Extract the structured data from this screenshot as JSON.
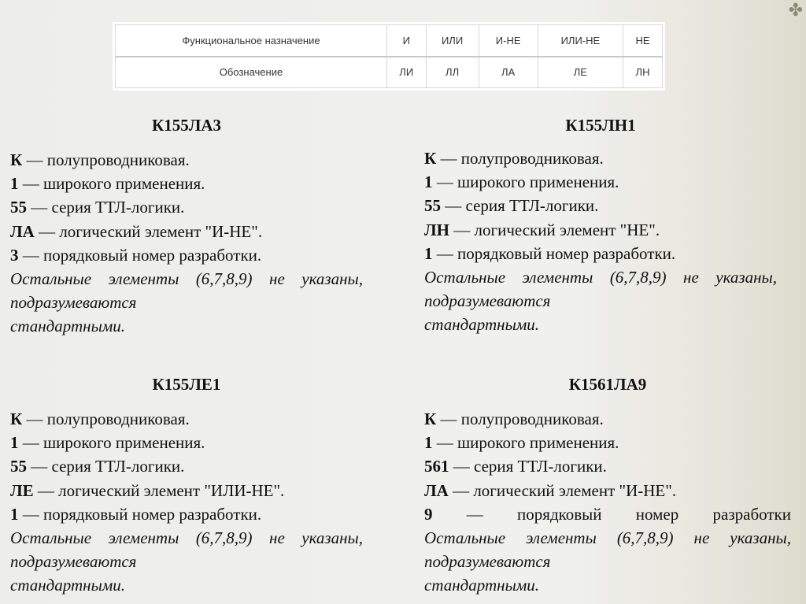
{
  "table": {
    "headers": [
      "Функциональное назначение",
      "И",
      "ИЛИ",
      "И-НЕ",
      "ИЛИ-НЕ",
      "НЕ"
    ],
    "codes": [
      "Обозначение",
      "ЛИ",
      "ЛЛ",
      "ЛА",
      "ЛЕ",
      "ЛН"
    ]
  },
  "decorations": {
    "corner_icon": "✤"
  },
  "blocks": [
    {
      "title": "К155ЛА3",
      "lines": [
        {
          "code": "К",
          "text": " — полупроводниковая."
        },
        {
          "code": "1",
          "text": " — широкого применения."
        },
        {
          "code": "55",
          "text": " — серия ТТЛ-логики."
        },
        {
          "code": "ЛА",
          "text": " — логический элемент \"И-НЕ\"."
        },
        {
          "code": "3",
          "text": " — порядковый номер разработки."
        }
      ],
      "note_main": "Остальные элементы (6,7,8,9) не указаны, подразумеваются",
      "note_last": "стандартными."
    },
    {
      "title": "К155ЛН1",
      "lines": [
        {
          "code": "К",
          "text": " — полупроводниковая."
        },
        {
          "code": "1",
          "text": " — широкого применения."
        },
        {
          "code": "55",
          "text": " — серия ТТЛ-логики."
        },
        {
          "code": "ЛН",
          "text": " — логический элемент \"НЕ\"."
        },
        {
          "code": "1",
          "text": " — порядковый номер разработки."
        }
      ],
      "note_main": "Остальные элементы (6,7,8,9) не указаны, подразумеваются",
      "note_last": "стандартными."
    },
    {
      "title": "К155ЛЕ1",
      "lines": [
        {
          "code": "К",
          "text": " — полупроводниковая."
        },
        {
          "code": "1",
          "text": " — широкого применения."
        },
        {
          "code": "55",
          "text": " — серия ТТЛ-логики."
        },
        {
          "code": "ЛЕ",
          "text": " — логический элемент \"ИЛИ-НЕ\"."
        },
        {
          "code": "1",
          "text": " — порядковый номер разработки."
        }
      ],
      "note_main": "Остальные элементы (6,7,8,9) не указаны, подразумеваются",
      "note_last": "стандартными."
    },
    {
      "title": "К1561ЛА9",
      "lines": [
        {
          "code": "К",
          "text": " — полупроводниковая."
        },
        {
          "code": "1",
          "text": " — широкого применения."
        },
        {
          "code": "561",
          "text": " — серия ТТЛ-логики."
        },
        {
          "code": "ЛА",
          "text": " — логический элемент \"И-НЕ\"."
        },
        {
          "code": "9",
          "text": " — порядковый номер разработки"
        }
      ],
      "note_main": "Остальные элементы (6,7,8,9) не указаны, подразумеваются",
      "note_last": "стандартными."
    }
  ]
}
